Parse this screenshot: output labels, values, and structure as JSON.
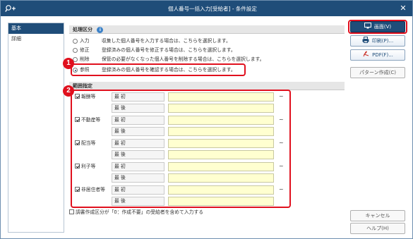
{
  "window": {
    "title": "個人番号一括入力[受給者] - 条件設定",
    "close_glyph": "✕"
  },
  "leftnav": {
    "items": [
      {
        "label": "基本",
        "active": true
      },
      {
        "label": "詳細",
        "active": false
      }
    ]
  },
  "processing": {
    "heading": "処理区分",
    "info_glyph": "i",
    "options": [
      {
        "label": "入力",
        "desc": "収集した個人番号を入力する場合は、こちらを選択します。",
        "checked": false
      },
      {
        "label": "修正",
        "desc": "登録済みの個人番号を修正する場合は、こちらを選択します。",
        "checked": false
      },
      {
        "label": "削除",
        "desc": "保管の必要がなくなった個人番号を削除する場合は、こちらを選択します。",
        "checked": false
      },
      {
        "label": "参照",
        "desc": "登録済みの個人番号を確認する場合は、こちらを選択します。",
        "checked": true
      }
    ]
  },
  "range": {
    "heading": "範囲指定",
    "first_label": "最 初",
    "last_label": "最 後",
    "tilde": "~",
    "categories": [
      {
        "label": "報酬等",
        "checked": true,
        "first_value": "",
        "last_value": ""
      },
      {
        "label": "不動産等",
        "checked": true,
        "first_value": "",
        "last_value": ""
      },
      {
        "label": "配当等",
        "checked": true,
        "first_value": "",
        "last_value": ""
      },
      {
        "label": "利子等",
        "checked": true,
        "first_value": "",
        "last_value": ""
      },
      {
        "label": "非居住者等",
        "checked": true,
        "first_value": "",
        "last_value": ""
      }
    ]
  },
  "bottom_option": {
    "label": "調書作成区分が「0：作成不要」の受給者を含めて入力する",
    "checked": false
  },
  "annotations": [
    "1",
    "2"
  ],
  "buttons": {
    "screen": "画面(V)",
    "print": "印刷(P)...",
    "pdf": "PDF(F)...",
    "pattern": "パターン作成(C)",
    "cancel": "キャンセル",
    "help": "ヘルプ(H)"
  },
  "colors": {
    "titlebar": "#1f4d79",
    "annotation": "#e0101e",
    "input_bg": "#ffffd0"
  }
}
